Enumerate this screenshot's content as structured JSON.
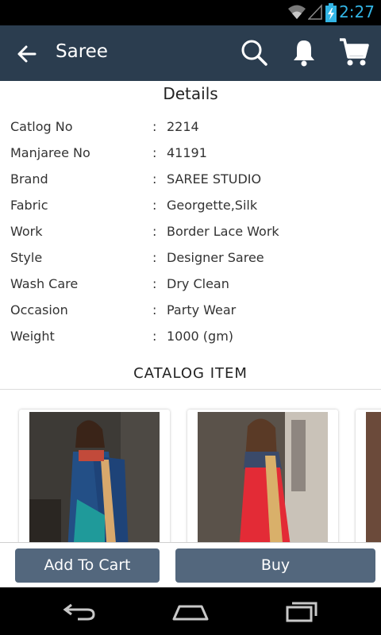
{
  "status_bar": {
    "time": "2:27",
    "accent": "#33b5e5"
  },
  "app_bar": {
    "title": "Saree",
    "background": "#2b3d4f"
  },
  "details": {
    "title": "Details",
    "rows": [
      {
        "label": "Catlog No",
        "separator": ":",
        "value": "2214"
      },
      {
        "label": "Manjaree No",
        "separator": ":",
        "value": "41191"
      },
      {
        "label": "Brand",
        "separator": ":",
        "value": "SAREE STUDIO"
      },
      {
        "label": "Fabric",
        "separator": ":",
        "value": "Georgette,Silk"
      },
      {
        "label": "Work",
        "separator": ":",
        "value": "Border Lace Work"
      },
      {
        "label": "Style",
        "separator": ":",
        "value": "Designer Saree"
      },
      {
        "label": "Wash Care",
        "separator": ":",
        "value": "Dry Clean"
      },
      {
        "label": "Occasion",
        "separator": ":",
        "value": "Party Wear"
      },
      {
        "label": "Weight",
        "separator": ":",
        "value": "1000 (gm)"
      }
    ]
  },
  "catalog": {
    "title": "CATALOG ITEM"
  },
  "actions": {
    "add_to_cart": "Add To Cart",
    "buy": "Buy",
    "button_color": "#53677d"
  }
}
